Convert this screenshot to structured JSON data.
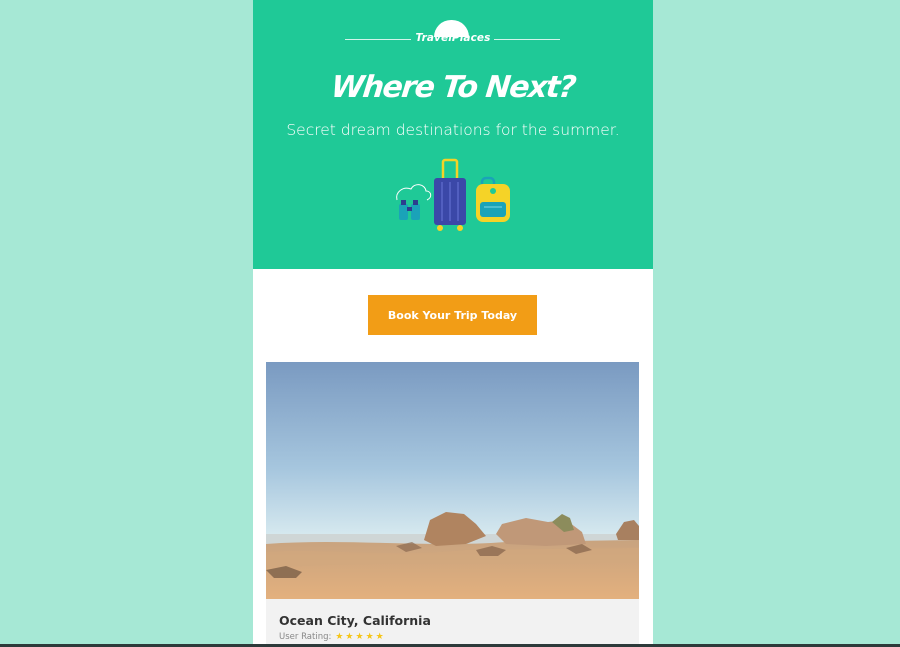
{
  "brand": {
    "name": "TravelPlaces"
  },
  "hero": {
    "headline": "Where To Next?",
    "subheadline": "Secret dream destinations for the summer."
  },
  "cta": {
    "label": "Book Your Trip Today"
  },
  "destination": {
    "title": "Ocean City, California",
    "rating_label": "User Rating:",
    "rating_stars": "★★★★★",
    "rating": 5
  },
  "colors": {
    "page_bg": "#a6e8d5",
    "hero_bg": "#1fc997",
    "cta_bg": "#f29d16",
    "card_bg": "#f2f2f2",
    "star": "#f5c518"
  },
  "icons": [
    "binoculars-icon",
    "suitcase-icon",
    "backpack-icon"
  ]
}
